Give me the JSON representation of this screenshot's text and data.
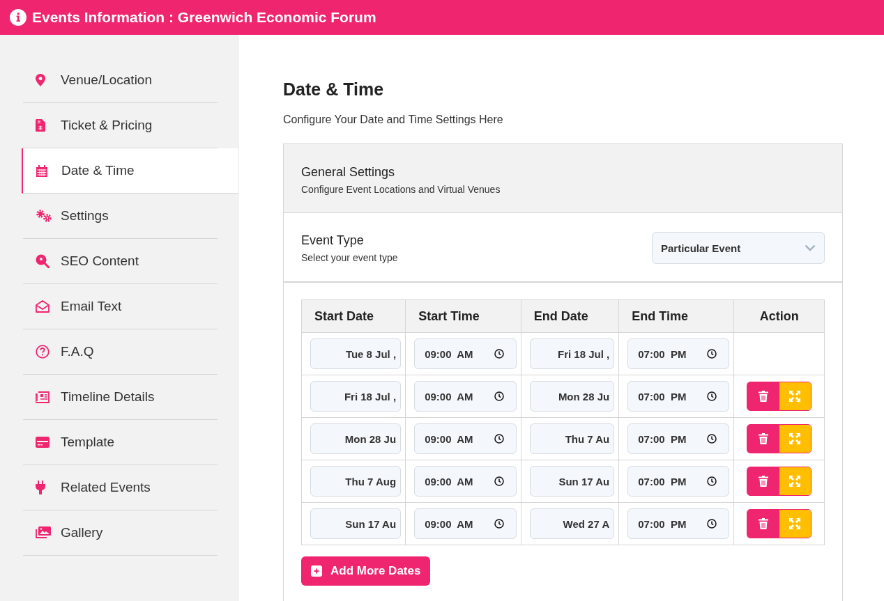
{
  "header": {
    "title": "Events Information : Greenwich Economic Forum"
  },
  "sidebar": {
    "items": [
      {
        "label": "Venue/Location",
        "selected": false
      },
      {
        "label": "Ticket & Pricing",
        "selected": false
      },
      {
        "label": "Date & Time",
        "selected": true
      },
      {
        "label": "Settings",
        "selected": false
      },
      {
        "label": "SEO Content",
        "selected": false
      },
      {
        "label": "Email Text",
        "selected": false
      },
      {
        "label": "F.A.Q",
        "selected": false
      },
      {
        "label": "Timeline Details",
        "selected": false
      },
      {
        "label": "Template",
        "selected": false
      },
      {
        "label": "Related Events",
        "selected": false
      },
      {
        "label": "Gallery",
        "selected": false
      }
    ]
  },
  "page": {
    "title": "Date & Time",
    "subtitle": "Configure Your Date and Time Settings Here"
  },
  "general_settings": {
    "title": "General Settings",
    "subtitle": "Configure Event Locations and Virtual Venues"
  },
  "event_type": {
    "label": "Event Type",
    "hint": "Select your event type",
    "value": "Particular Event"
  },
  "table": {
    "columns": [
      "Start Date",
      "Start Time",
      "End Date",
      "End Time",
      "Action"
    ],
    "rows": [
      {
        "start_date": "Tue 8 Jul ,",
        "start_time": "09:00  AM",
        "end_date": "Fri 18 Jul ,",
        "end_time": "07:00  PM",
        "actions": false
      },
      {
        "start_date": "Fri 18 Jul ,",
        "start_time": "09:00  AM",
        "end_date": "Mon 28 Ju",
        "end_time": "07:00  PM",
        "actions": true
      },
      {
        "start_date": "Mon 28 Ju",
        "start_time": "09:00  AM",
        "end_date": "Thu 7 Au",
        "end_time": "07:00  PM",
        "actions": true
      },
      {
        "start_date": "Thu 7 Aug",
        "start_time": "09:00  AM",
        "end_date": "Sun 17 Au",
        "end_time": "07:00  PM",
        "actions": true
      },
      {
        "start_date": "Sun 17 Au",
        "start_time": "09:00  AM",
        "end_date": "Wed 27 A",
        "end_time": "07:00  PM",
        "actions": true
      }
    ]
  },
  "add_button": {
    "label": "Add More Dates"
  }
}
